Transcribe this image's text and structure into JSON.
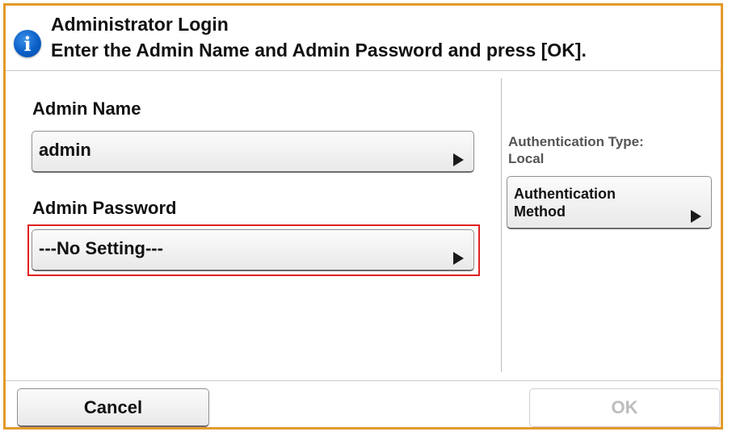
{
  "header": {
    "icon": "info-icon",
    "icon_glyph": "i",
    "title": "Administrator Login",
    "message": "Enter the Admin Name and Admin Password and press [OK]."
  },
  "admin_name": {
    "label": "Admin Name",
    "value": "admin"
  },
  "admin_password": {
    "label": "Admin Password",
    "value": "---No Setting---"
  },
  "authentication": {
    "type_label": "Authentication Type:",
    "type_value": "Local",
    "method_button_line1": "Authentication",
    "method_button_line2": "Method"
  },
  "footer": {
    "cancel_label": "Cancel",
    "ok_label": "OK"
  },
  "colors": {
    "frame_border": "#e39a2a",
    "highlight": "#e02020",
    "info_icon": "#0a5fc7"
  }
}
